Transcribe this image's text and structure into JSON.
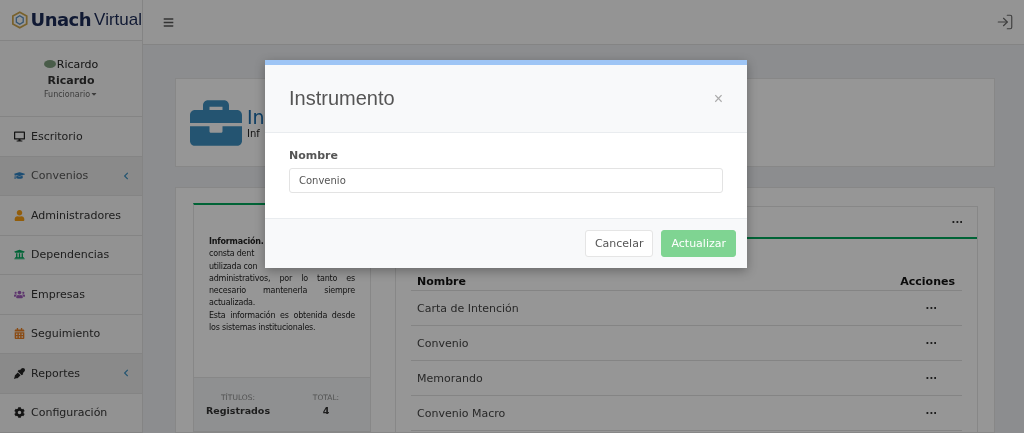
{
  "brand": {
    "bold": "Unach",
    "light": "Virtual"
  },
  "user": {
    "avatar_alt": "Ricardo",
    "name": "Ricardo",
    "role": "Funcionario"
  },
  "sidebar": {
    "items": [
      {
        "label": "Escritorio",
        "selected": false,
        "has_submenu": false
      },
      {
        "label": "Convenios",
        "selected": true,
        "has_submenu": true
      },
      {
        "label": "Administradores",
        "selected": false,
        "has_submenu": false
      },
      {
        "label": "Dependencias",
        "selected": false,
        "has_submenu": false
      },
      {
        "label": "Empresas",
        "selected": false,
        "has_submenu": false
      },
      {
        "label": "Seguimiento",
        "selected": false,
        "has_submenu": false
      },
      {
        "label": "Reportes",
        "selected": false,
        "has_submenu": true
      },
      {
        "label": "Configuración",
        "selected": false,
        "has_submenu": false
      }
    ]
  },
  "page_header": {
    "title": "In",
    "subtitle": "Inf"
  },
  "info_card": {
    "lines_top": [
      "**Información.**",
      "consta dent",
      "utilizada con"
    ],
    "text": "administrativos, por lo tanto es necesario mantenerla siempre actualizada.",
    "text2": "Esta información es obtenida desde los sistemas institucionales.",
    "stats": [
      {
        "label": "TÍTULOS:",
        "value": "Registrados"
      },
      {
        "label": "TOTAL:",
        "value": "4"
      }
    ]
  },
  "table": {
    "menu": "···",
    "columns": [
      "Nombre",
      "Acciones"
    ],
    "rows": [
      {
        "name": "Carta de Intención",
        "action": "···"
      },
      {
        "name": "Convenio",
        "action": "···"
      },
      {
        "name": "Memorando",
        "action": "···"
      },
      {
        "name": "Convenio Macro",
        "action": "···"
      }
    ]
  },
  "modal": {
    "title": "Instrumento",
    "close": "×",
    "field_label": "Nombre",
    "field_value": "Convenio",
    "buttons": [
      {
        "label": "Cancelar",
        "kind": "secondary"
      },
      {
        "label": "Actualizar",
        "kind": "primary"
      }
    ]
  }
}
